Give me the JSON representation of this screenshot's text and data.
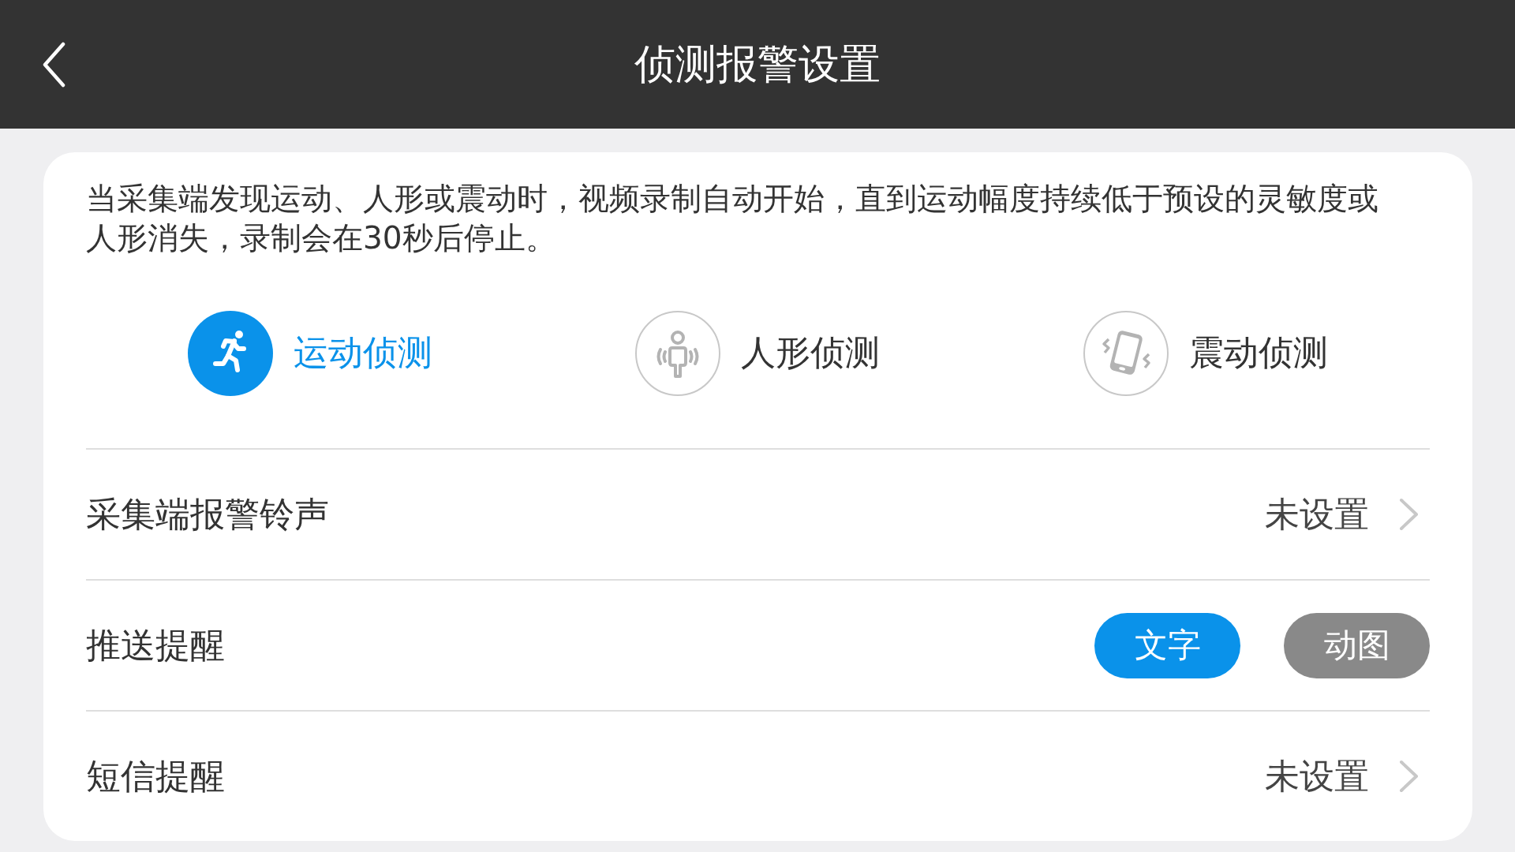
{
  "header": {
    "title": "侦测报警设置"
  },
  "description": "当采集端发现运动、人形或震动时，视频录制自动开始，直到运动幅度持续低于预设的灵敏度或人形消失，录制会在30秒后停止。",
  "detection_modes": [
    {
      "kind": "motion",
      "label": "运动侦测",
      "selected": true
    },
    {
      "kind": "human",
      "label": "人形侦测",
      "selected": false
    },
    {
      "kind": "vibration",
      "label": "震动侦测",
      "selected": false
    }
  ],
  "settings": [
    {
      "kind": "link",
      "label": "采集端报警铃声",
      "value": "未设置"
    },
    {
      "kind": "choice",
      "label": "推送提醒",
      "options": [
        {
          "label": "文字",
          "selected": true
        },
        {
          "label": "动图",
          "selected": false
        }
      ]
    },
    {
      "kind": "link",
      "label": "短信提醒",
      "value": "未设置"
    }
  ]
}
